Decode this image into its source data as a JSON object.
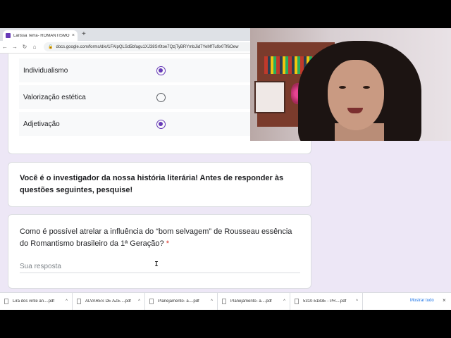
{
  "browser": {
    "tab_title": "Larissa Terra- ROMANTISMO",
    "tab_close": "×",
    "new_tab": "+",
    "url": "docs.google.com/forms/d/e/1FAIpQLSd5bfagu1XJ38Sr0toe7QzjTyBRYmbJid7YeMfTu9x0Tf6Oew"
  },
  "grid": {
    "rows": [
      {
        "label": "Individualismo",
        "selected": true
      },
      {
        "label": "Valorização estética",
        "selected": false
      },
      {
        "label": "Adjetivação",
        "selected": true
      }
    ]
  },
  "info": {
    "text": "Você é o investigador da nossa história literária! Antes de responder às questões seguintes, pesquise!"
  },
  "question": {
    "text": "Como é possível atrelar a influência do “bom selvagem” de Rousseau essência do Romantismo brasileiro da 1ª Geração?",
    "required_mark": "*",
    "placeholder": "Sua resposta"
  },
  "cursor": "I",
  "downloads": {
    "items": [
      "Lira dos vinte an....pdf",
      "ALVARES DE AZE....pdf",
      "Planejamento- a....pdf",
      "Planejamento- a....pdf",
      "5310-5183E - PR....pdf"
    ],
    "show_all": "Mostrar tudo",
    "close": "×"
  },
  "colors": {
    "accent": "#673ab7",
    "background": "#ede7f6",
    "required": "#d93025"
  }
}
